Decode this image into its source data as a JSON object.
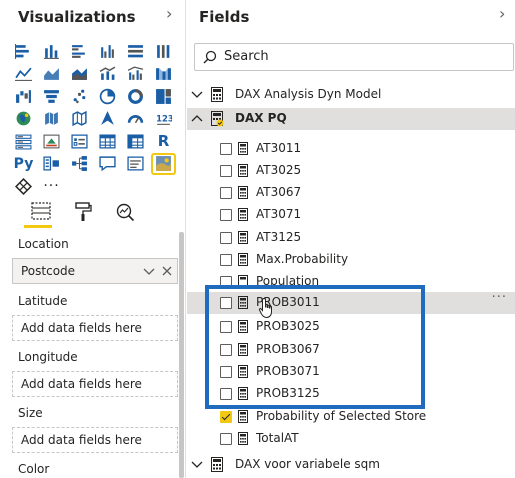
{
  "visualizations": {
    "title": "Visualizations",
    "grid_icons": [
      [
        "stacked-bar-icon",
        "stacked-column-icon",
        "clustered-bar-icon",
        "clustered-column-icon",
        "100-bar-icon",
        "100-column-icon"
      ],
      [
        "line-chart-icon",
        "area-chart-icon",
        "stacked-area-icon",
        "line-column-icon",
        "line-clustered-icon",
        "ribbon-chart-icon"
      ],
      [
        "waterfall-icon",
        "funnel-icon",
        "scatter-icon",
        "pie-icon",
        "donut-icon",
        "treemap-icon"
      ],
      [
        "map-icon",
        "filled-map-icon",
        "shape-map-icon",
        "azure-map-icon",
        "gauge-icon",
        "card-icon"
      ],
      [
        "multi-row-card-icon",
        "kpi-icon",
        "slicer-icon",
        "table-icon",
        "matrix-icon",
        "r-visual-icon"
      ],
      [
        "python-visual-icon",
        "key-influencers-icon",
        "decomposition-tree-icon",
        "qa-icon",
        "smart-narrative-icon",
        "arcgis-map-icon"
      ],
      [
        "power-apps-icon",
        "more-visuals-icon"
      ]
    ],
    "py_text": "Py",
    "r_text": "R",
    "more_text": "···",
    "wells": [
      {
        "label": "Location",
        "value": "Postcode",
        "filled": true
      },
      {
        "label": "Latitude",
        "value": "Add data fields here",
        "filled": false
      },
      {
        "label": "Longitude",
        "value": "Add data fields here",
        "filled": false
      },
      {
        "label": "Size",
        "value": "Add data fields here",
        "filled": false
      },
      {
        "label": "Color",
        "value": "",
        "filled": false
      }
    ]
  },
  "fields": {
    "title": "Fields",
    "search_placeholder": "Search",
    "tables": [
      {
        "name": "DAX Analysis Dyn Model",
        "expanded": false
      },
      {
        "name": "DAX PQ",
        "expanded": true
      },
      {
        "name": "DAX voor variabele sqm",
        "expanded": false
      }
    ],
    "measures": [
      {
        "name": "AT3011",
        "checked": false
      },
      {
        "name": "AT3025",
        "checked": false
      },
      {
        "name": "AT3067",
        "checked": false
      },
      {
        "name": "AT3071",
        "checked": false
      },
      {
        "name": "AT3125",
        "checked": false
      },
      {
        "name": "Max.Probability",
        "checked": false
      },
      {
        "name": "Population",
        "checked": false
      },
      {
        "name": "PROB3011",
        "checked": false
      },
      {
        "name": "PROB3025",
        "checked": false
      },
      {
        "name": "PROB3067",
        "checked": false
      },
      {
        "name": "PROB3071",
        "checked": false
      },
      {
        "name": "PROB3125",
        "checked": false
      },
      {
        "name": "Probability of Selected Store",
        "checked": true
      },
      {
        "name": "TotalAT",
        "checked": false
      }
    ],
    "more_text": "···"
  },
  "colors": {
    "accent_yellow": "#f2c811",
    "highlight_blue": "#1f6cbf",
    "icon_blue": "#1a5ea6"
  }
}
